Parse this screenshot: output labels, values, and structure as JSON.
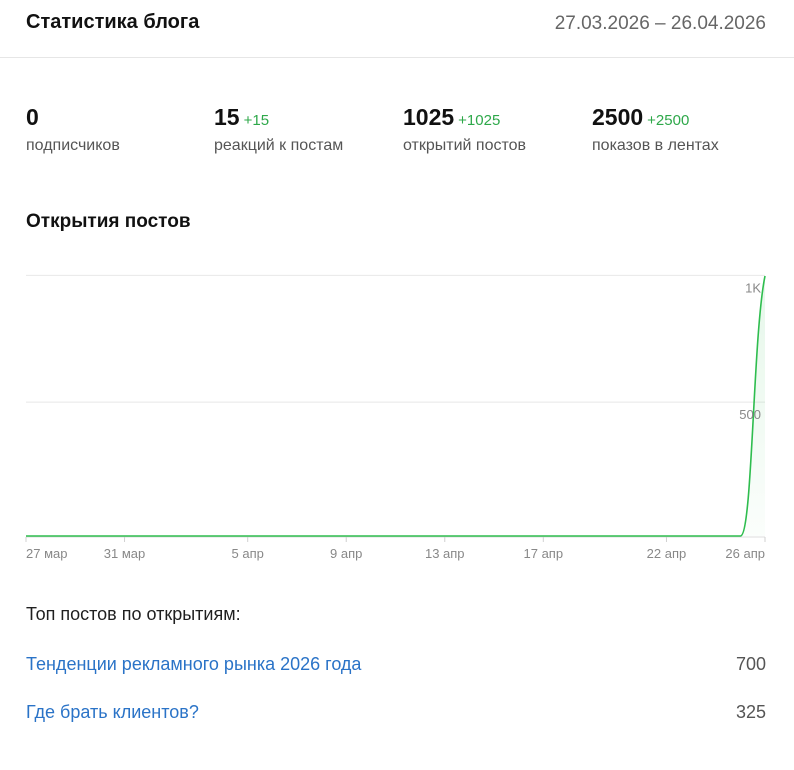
{
  "header": {
    "title": "Статистика блога",
    "date_range": "27.03.2026 – 26.04.2026"
  },
  "stats": [
    {
      "value": "0",
      "delta": "",
      "label": "подписчиков"
    },
    {
      "value": "15",
      "delta": "+15",
      "label": "реакций к постам"
    },
    {
      "value": "1025",
      "delta": "+1025",
      "label": "открытий постов"
    },
    {
      "value": "2500",
      "delta": "+2500",
      "label": "показов в лентах"
    }
  ],
  "chart_title": "Открытия постов",
  "chart_data": {
    "type": "area",
    "x": [
      "27 мар",
      "28 мар",
      "29 мар",
      "30 мар",
      "31 мар",
      "1 апр",
      "2 апр",
      "3 апр",
      "4 апр",
      "5 апр",
      "6 апр",
      "7 апр",
      "8 апр",
      "9 апр",
      "10 апр",
      "11 апр",
      "12 апр",
      "13 апр",
      "14 апр",
      "15 апр",
      "16 апр",
      "17 апр",
      "18 апр",
      "19 апр",
      "20 апр",
      "21 апр",
      "22 апр",
      "23 апр",
      "24 апр",
      "25 апр",
      "26 апр"
    ],
    "series": [
      {
        "values": [
          0,
          0,
          0,
          0,
          0,
          0,
          0,
          0,
          0,
          0,
          0,
          0,
          0,
          0,
          0,
          0,
          0,
          0,
          0,
          0,
          0,
          0,
          0,
          0,
          0,
          0,
          0,
          0,
          0,
          0,
          1025
        ]
      }
    ],
    "x_tick_labels": [
      "27 мар",
      "31 мар",
      "5 апр",
      "9 апр",
      "13 апр",
      "17 апр",
      "22 апр",
      "26 апр"
    ],
    "y_tick_labels": [
      "1K",
      "500"
    ],
    "y_ticks": [
      1000,
      500
    ],
    "ylim": [
      0,
      1025
    ],
    "grid": true,
    "color": "#2ebd4e"
  },
  "top_posts": {
    "title": "Топ постов по открытиям:",
    "items": [
      {
        "title": "Тенденции рекламного рынка 2026 года",
        "count": "700"
      },
      {
        "title": "Где брать клиентов?",
        "count": "325"
      }
    ]
  }
}
